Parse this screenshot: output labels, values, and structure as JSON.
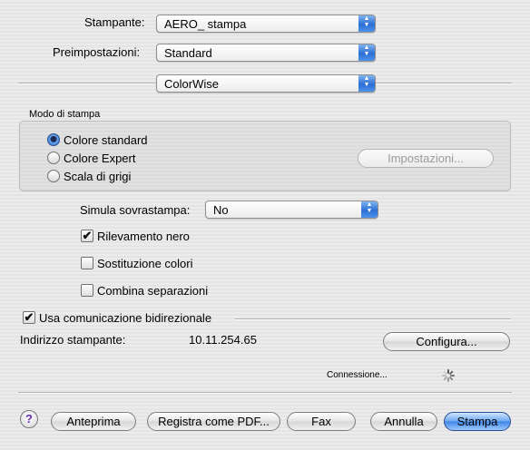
{
  "printer": {
    "label": "Stampante:",
    "value": "AERO_ stampa"
  },
  "presets": {
    "label": "Preimpostazioni:",
    "value": "Standard"
  },
  "panel": {
    "value": "ColorWise"
  },
  "print_mode": {
    "group_title": "Modo di stampa",
    "options": [
      {
        "label": "Colore standard",
        "selected": true
      },
      {
        "label": "Colore Expert",
        "selected": false
      },
      {
        "label": "Scala di grigi",
        "selected": false
      }
    ],
    "settings_button": "Impostazioni..."
  },
  "overprint": {
    "label": "Simula sovrastampa:",
    "value": "No"
  },
  "checkboxes": [
    {
      "label": "Rilevamento nero",
      "checked": true
    },
    {
      "label": "Sostituzione colori",
      "checked": false
    },
    {
      "label": "Combina separazioni",
      "checked": false
    }
  ],
  "bidirectional": {
    "label": "Usa comunicazione bidirezionale",
    "checked": true,
    "address_label": "Indirizzo stampante:",
    "address_value": "10.11.254.65",
    "configure_button": "Configura...",
    "status": "Connessione..."
  },
  "footer": {
    "help": "?",
    "preview": "Anteprima",
    "save_pdf": "Registra come PDF...",
    "fax": "Fax",
    "cancel": "Annulla",
    "print": "Stampa"
  },
  "icons": {
    "checkmark": "✔",
    "popup_arrows": [
      "▲",
      "▼"
    ]
  }
}
